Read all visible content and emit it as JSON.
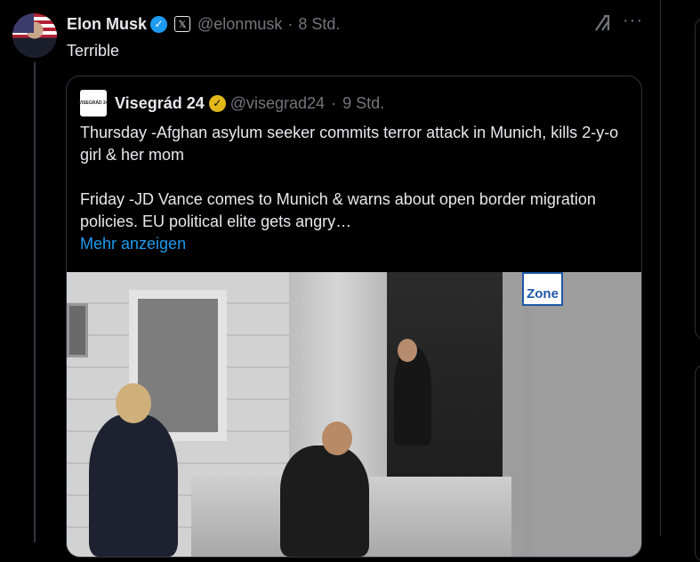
{
  "tweet": {
    "author_name": "Elon Musk",
    "verified_mark": "✓",
    "x_badge": "𝕏",
    "handle": "@elonmusk",
    "separator": "·",
    "time": "8 Std.",
    "text": "Terrible",
    "grok_icon": "grok-icon",
    "more_icon": "more-icon",
    "more_glyph": "···"
  },
  "quote": {
    "avatar_text": "VISEGRÁD 24",
    "author_name": "Visegrád 24",
    "verified_mark": "✓",
    "handle": "@visegrad24",
    "separator": "·",
    "time": "9 Std.",
    "paragraph_1": "Thursday -Afghan asylum seeker commits terror attack in Munich, kills 2-y-o girl & her mom",
    "paragraph_2": "Friday -JD Vance comes to Munich & warns about open border migration policies. EU political elite gets angry…",
    "show_more": "Mehr anzeigen",
    "photo": {
      "sign_text": "Zone"
    }
  },
  "colors": {
    "background": "#000000",
    "text": "#e7e9ea",
    "secondary": "#71767b",
    "link": "#1d9bf0",
    "verified_blue": "#1d9bf0",
    "verified_gold": "#e2b719",
    "border": "#2f3336"
  }
}
